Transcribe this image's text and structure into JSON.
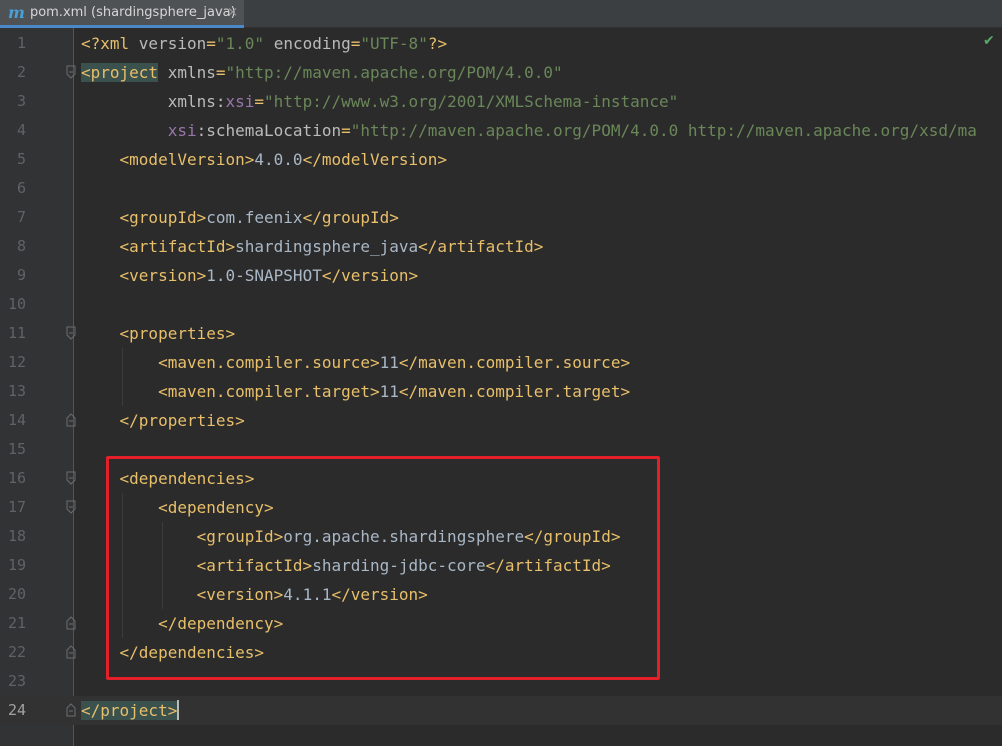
{
  "tab": {
    "icon": "m",
    "title": "pom.xml (shardingsphere_java)",
    "close": "×"
  },
  "status": {
    "check_icon": "✔"
  },
  "lines": [
    {
      "n": "1",
      "segs": [
        [
          "t-tag",
          "<?xml "
        ],
        [
          "t-attr",
          "version"
        ],
        [
          "t-tag",
          "="
        ],
        [
          "t-str",
          "\"1.0\""
        ],
        [
          "t-tag",
          " "
        ],
        [
          "t-attr",
          "encoding"
        ],
        [
          "t-tag",
          "="
        ],
        [
          "t-str",
          "\"UTF-8\""
        ],
        [
          "t-tag",
          "?>"
        ]
      ]
    },
    {
      "n": "2",
      "segs": [
        [
          "t-tag hl",
          "<project"
        ],
        [
          "t-attr",
          " xmlns"
        ],
        [
          "t-tag",
          "="
        ],
        [
          "t-str",
          "\"http://maven.apache.org/POM/4.0.0\""
        ]
      ]
    },
    {
      "n": "3",
      "segs": [
        [
          "t-attr",
          "         xmlns:"
        ],
        [
          "t-ns",
          "xsi"
        ],
        [
          "t-tag",
          "="
        ],
        [
          "t-str",
          "\"http://www.w3.org/2001/XMLSchema-instance\""
        ]
      ]
    },
    {
      "n": "4",
      "segs": [
        [
          "t-ns",
          "         xsi"
        ],
        [
          "t-attr",
          ":schemaLocation"
        ],
        [
          "t-tag",
          "="
        ],
        [
          "t-str",
          "\"http://maven.apache.org/POM/4.0.0 http://maven.apache.org/xsd/ma"
        ]
      ]
    },
    {
      "n": "5",
      "segs": [
        [
          "t-tag",
          "    <modelVersion>"
        ],
        [
          "t-txt",
          "4.0.0"
        ],
        [
          "t-tag",
          "</modelVersion>"
        ]
      ]
    },
    {
      "n": "6",
      "segs": []
    },
    {
      "n": "7",
      "segs": [
        [
          "t-tag",
          "    <groupId>"
        ],
        [
          "t-txt",
          "com.feenix"
        ],
        [
          "t-tag",
          "</groupId>"
        ]
      ]
    },
    {
      "n": "8",
      "segs": [
        [
          "t-tag",
          "    <artifactId>"
        ],
        [
          "t-txt",
          "shardingsphere_java"
        ],
        [
          "t-tag",
          "</artifactId>"
        ]
      ]
    },
    {
      "n": "9",
      "segs": [
        [
          "t-tag",
          "    <version>"
        ],
        [
          "t-txt",
          "1.0-SNAPSHOT"
        ],
        [
          "t-tag",
          "</version>"
        ]
      ]
    },
    {
      "n": "10",
      "segs": []
    },
    {
      "n": "11",
      "segs": [
        [
          "t-tag",
          "    <properties>"
        ]
      ]
    },
    {
      "n": "12",
      "segs": [
        [
          "t-tag",
          "        <maven.compiler.source>"
        ],
        [
          "t-txt",
          "11"
        ],
        [
          "t-tag",
          "</maven.compiler.source>"
        ]
      ]
    },
    {
      "n": "13",
      "segs": [
        [
          "t-tag",
          "        <maven.compiler.target>"
        ],
        [
          "t-txt",
          "11"
        ],
        [
          "t-tag",
          "</maven.compiler.target>"
        ]
      ]
    },
    {
      "n": "14",
      "segs": [
        [
          "t-tag",
          "    </properties>"
        ]
      ]
    },
    {
      "n": "15",
      "segs": []
    },
    {
      "n": "16",
      "segs": [
        [
          "t-tag",
          "    <dependencies>"
        ]
      ]
    },
    {
      "n": "17",
      "segs": [
        [
          "t-tag",
          "        <dependency>"
        ]
      ]
    },
    {
      "n": "18",
      "segs": [
        [
          "t-tag",
          "            <groupId>"
        ],
        [
          "t-txt",
          "org.apache.shardingsphere"
        ],
        [
          "t-tag",
          "</groupId>"
        ]
      ]
    },
    {
      "n": "19",
      "segs": [
        [
          "t-tag",
          "            <artifactId>"
        ],
        [
          "t-txt",
          "sharding-jdbc-core"
        ],
        [
          "t-tag",
          "</artifactId>"
        ]
      ]
    },
    {
      "n": "20",
      "segs": [
        [
          "t-tag",
          "            <version>"
        ],
        [
          "t-txt",
          "4.1.1"
        ],
        [
          "t-tag",
          "</version>"
        ]
      ]
    },
    {
      "n": "21",
      "segs": [
        [
          "t-tag",
          "        </dependency>"
        ]
      ]
    },
    {
      "n": "22",
      "segs": [
        [
          "t-tag",
          "    </dependencies>"
        ]
      ]
    },
    {
      "n": "23",
      "segs": []
    },
    {
      "n": "24",
      "segs": [
        [
          "t-tag hl",
          "</project>"
        ]
      ]
    }
  ]
}
